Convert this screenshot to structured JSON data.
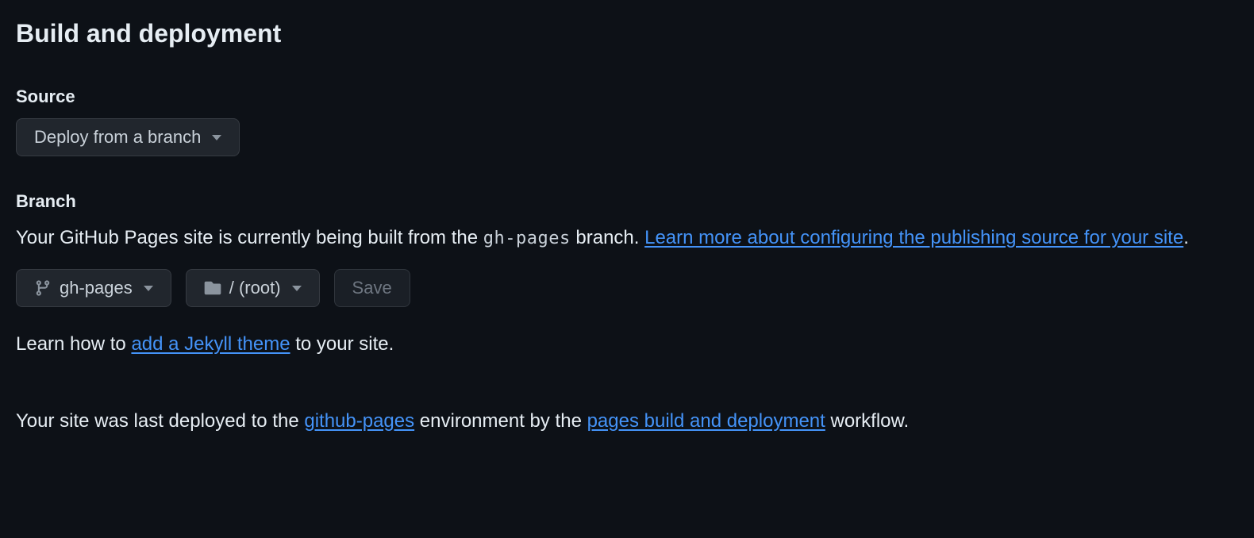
{
  "section": {
    "title": "Build and deployment"
  },
  "source": {
    "label": "Source",
    "selected": "Deploy from a branch"
  },
  "branch": {
    "label": "Branch",
    "desc_prefix": "Your GitHub Pages site is currently being built from the ",
    "branch_code": "gh-pages",
    "desc_mid": " branch. ",
    "learn_link": "Learn more about configuring the publishing source for your site",
    "desc_suffix": ".",
    "selector_branch": "gh-pages",
    "selector_folder": "/ (root)",
    "save_label": "Save"
  },
  "jekyll": {
    "prefix": "Learn how to ",
    "link": "add a Jekyll theme",
    "suffix": " to your site."
  },
  "deploy": {
    "prefix": "Your site was last deployed to the ",
    "env_link": "github-pages",
    "mid": " environment by the ",
    "workflow_link": "pages build and deployment",
    "suffix": " workflow."
  }
}
